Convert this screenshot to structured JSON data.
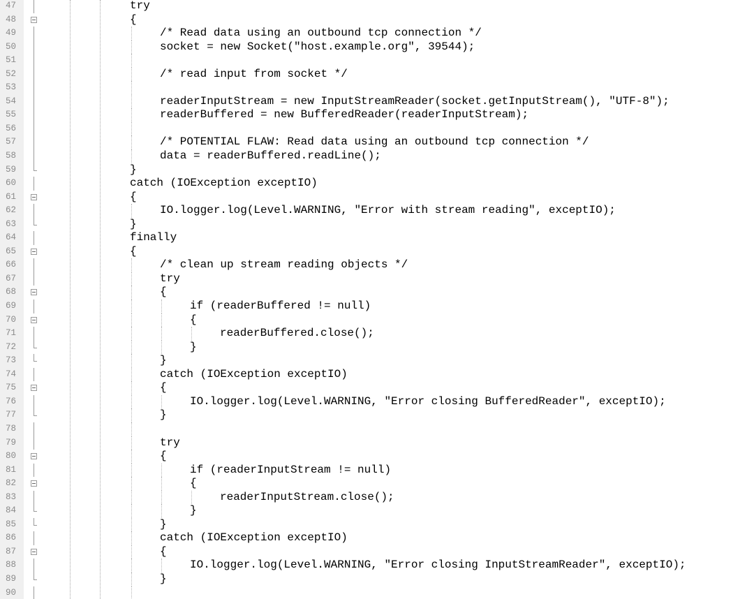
{
  "editor": {
    "lines": [
      {
        "n": "47",
        "code": "try",
        "indent": 0,
        "fold": "vline"
      },
      {
        "n": "48",
        "code": "{",
        "indent": 0,
        "fold": "box"
      },
      {
        "n": "49",
        "code": "/* Read data using an outbound tcp connection */",
        "indent": 1,
        "fold": "vline"
      },
      {
        "n": "50",
        "code": "socket = new Socket(\"host.example.org\", 39544);",
        "indent": 1,
        "fold": "vline"
      },
      {
        "n": "51",
        "code": "",
        "indent": 1,
        "fold": "vline"
      },
      {
        "n": "52",
        "code": "/* read input from socket */",
        "indent": 1,
        "fold": "vline"
      },
      {
        "n": "53",
        "code": "",
        "indent": 1,
        "fold": "vline"
      },
      {
        "n": "54",
        "code": "readerInputStream = new InputStreamReader(socket.getInputStream(), \"UTF-8\");",
        "indent": 1,
        "fold": "vline"
      },
      {
        "n": "55",
        "code": "readerBuffered = new BufferedReader(readerInputStream);",
        "indent": 1,
        "fold": "vline"
      },
      {
        "n": "56",
        "code": "",
        "indent": 1,
        "fold": "vline"
      },
      {
        "n": "57",
        "code": "/* POTENTIAL FLAW: Read data using an outbound tcp connection */",
        "indent": 1,
        "fold": "vline"
      },
      {
        "n": "58",
        "code": "data = readerBuffered.readLine();",
        "indent": 1,
        "fold": "vline"
      },
      {
        "n": "59",
        "code": "}",
        "indent": 0,
        "fold": "end"
      },
      {
        "n": "60",
        "code": "catch (IOException exceptIO)",
        "indent": 0,
        "fold": "vline"
      },
      {
        "n": "61",
        "code": "{",
        "indent": 0,
        "fold": "box"
      },
      {
        "n": "62",
        "code": "IO.logger.log(Level.WARNING, \"Error with stream reading\", exceptIO);",
        "indent": 1,
        "fold": "vline"
      },
      {
        "n": "63",
        "code": "}",
        "indent": 0,
        "fold": "end"
      },
      {
        "n": "64",
        "code": "finally",
        "indent": 0,
        "fold": "vline"
      },
      {
        "n": "65",
        "code": "{",
        "indent": 0,
        "fold": "box"
      },
      {
        "n": "66",
        "code": "/* clean up stream reading objects */",
        "indent": 1,
        "fold": "vline"
      },
      {
        "n": "67",
        "code": "try",
        "indent": 1,
        "fold": "vline"
      },
      {
        "n": "68",
        "code": "{",
        "indent": 1,
        "fold": "box"
      },
      {
        "n": "69",
        "code": "if (readerBuffered != null)",
        "indent": 2,
        "fold": "vline"
      },
      {
        "n": "70",
        "code": "{",
        "indent": 2,
        "fold": "box"
      },
      {
        "n": "71",
        "code": "readerBuffered.close();",
        "indent": 3,
        "fold": "vline"
      },
      {
        "n": "72",
        "code": "}",
        "indent": 2,
        "fold": "end"
      },
      {
        "n": "73",
        "code": "}",
        "indent": 1,
        "fold": "end"
      },
      {
        "n": "74",
        "code": "catch (IOException exceptIO)",
        "indent": 1,
        "fold": "vline"
      },
      {
        "n": "75",
        "code": "{",
        "indent": 1,
        "fold": "box"
      },
      {
        "n": "76",
        "code": "IO.logger.log(Level.WARNING, \"Error closing BufferedReader\", exceptIO);",
        "indent": 2,
        "fold": "vline"
      },
      {
        "n": "77",
        "code": "}",
        "indent": 1,
        "fold": "end"
      },
      {
        "n": "78",
        "code": "",
        "indent": 1,
        "fold": "vline"
      },
      {
        "n": "79",
        "code": "try",
        "indent": 1,
        "fold": "vline"
      },
      {
        "n": "80",
        "code": "{",
        "indent": 1,
        "fold": "box"
      },
      {
        "n": "81",
        "code": "if (readerInputStream != null)",
        "indent": 2,
        "fold": "vline"
      },
      {
        "n": "82",
        "code": "{",
        "indent": 2,
        "fold": "box"
      },
      {
        "n": "83",
        "code": "readerInputStream.close();",
        "indent": 3,
        "fold": "vline"
      },
      {
        "n": "84",
        "code": "}",
        "indent": 2,
        "fold": "end"
      },
      {
        "n": "85",
        "code": "}",
        "indent": 1,
        "fold": "end"
      },
      {
        "n": "86",
        "code": "catch (IOException exceptIO)",
        "indent": 1,
        "fold": "vline"
      },
      {
        "n": "87",
        "code": "{",
        "indent": 1,
        "fold": "box"
      },
      {
        "n": "88",
        "code": "IO.logger.log(Level.WARNING, \"Error closing InputStreamReader\", exceptIO);",
        "indent": 2,
        "fold": "vline"
      },
      {
        "n": "89",
        "code": "}",
        "indent": 1,
        "fold": "end"
      },
      {
        "n": "90",
        "code": "",
        "indent": 1,
        "fold": "vline"
      }
    ]
  }
}
